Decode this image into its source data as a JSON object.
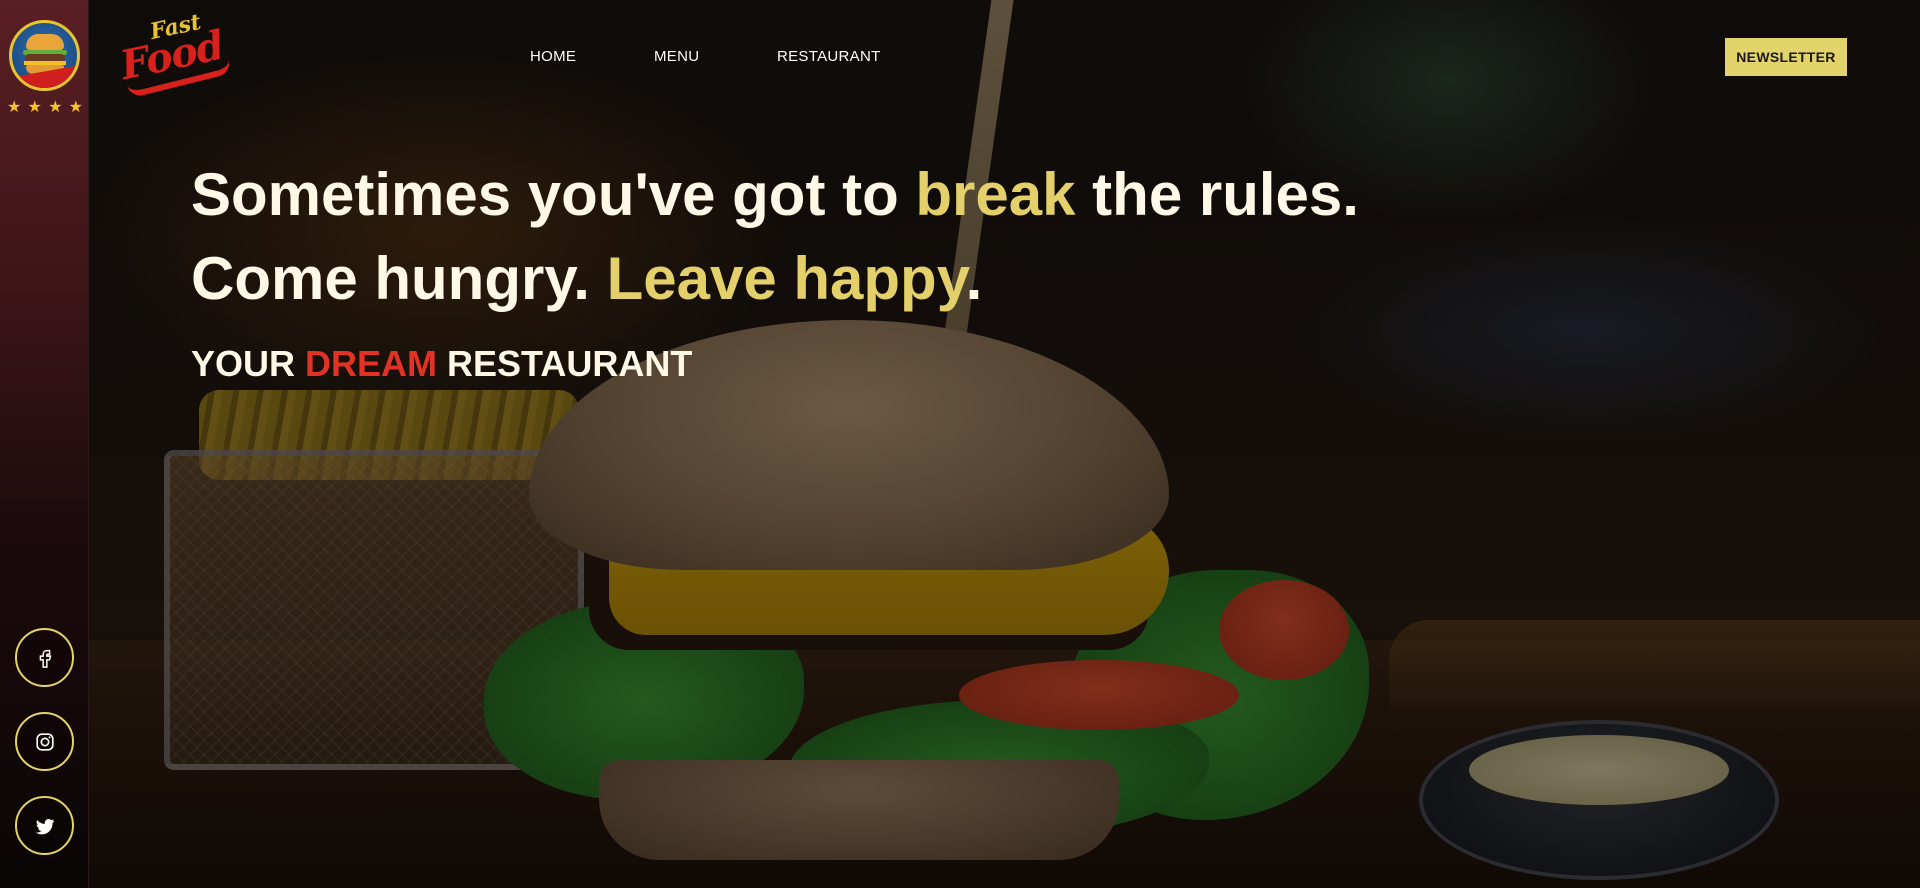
{
  "brand": {
    "logo_text_top": "Fast",
    "logo_text_bottom": "Food",
    "rating_stars": 4,
    "colors": {
      "accent": "#e3d06b",
      "red": "#e23226",
      "button": "#e2d36a"
    }
  },
  "nav": {
    "items": [
      "HOME",
      "MENU",
      "RESTAURANT"
    ],
    "newsletter": "NEWSLETTER"
  },
  "hero": {
    "line1": {
      "before": "Sometimes you've got to ",
      "highlight": "break",
      "after": " the rules."
    },
    "line2": {
      "before": "Come hungry. ",
      "highlight": "Leave happy",
      "after": "."
    },
    "line3": {
      "before": "YOUR ",
      "highlight": "DREAM",
      "after": " RESTAURANT"
    }
  },
  "social": [
    {
      "icon": "facebook-icon"
    },
    {
      "icon": "instagram-icon"
    },
    {
      "icon": "twitter-icon"
    }
  ]
}
